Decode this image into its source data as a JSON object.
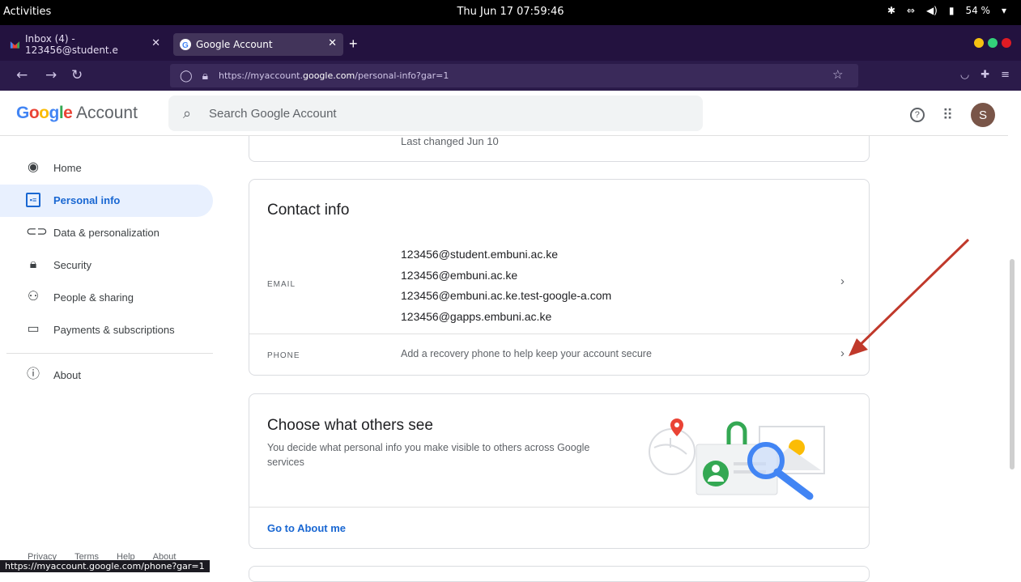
{
  "system": {
    "activities": "Activities",
    "clock": "Thu Jun 17  07:59:46",
    "battery": "54 %"
  },
  "browser": {
    "tabs": [
      {
        "title": "Inbox (4) - 123456@student.e"
      },
      {
        "title": "Google Account"
      }
    ],
    "url_prefix": "https://myaccount.",
    "url_domain": "google.com",
    "url_suffix": "/personal-info?gar=1",
    "status_url": "https://myaccount.google.com/phone?gar=1"
  },
  "app": {
    "logo_google": "Google",
    "logo_account": " Account",
    "search_placeholder": "Search Google Account",
    "avatar_letter": "S"
  },
  "sidebar": {
    "items": [
      {
        "label": "Home",
        "icon": "account-circle-icon"
      },
      {
        "label": "Personal info",
        "icon": "id-card-icon"
      },
      {
        "label": "Data & personalization",
        "icon": "toggle-icon"
      },
      {
        "label": "Security",
        "icon": "lock-icon"
      },
      {
        "label": "People & sharing",
        "icon": "people-icon"
      },
      {
        "label": "Payments & subscriptions",
        "icon": "credit-card-icon"
      },
      {
        "label": "About",
        "icon": "info-icon"
      }
    ],
    "footer": [
      "Privacy",
      "Terms",
      "Help",
      "About"
    ]
  },
  "password_card": {
    "last_changed": "Last changed Jun 10"
  },
  "contact": {
    "title": "Contact info",
    "email_label": "EMAIL",
    "emails": [
      "123456@student.embuni.ac.ke",
      "123456@embuni.ac.ke",
      "123456@embuni.ac.ke.test-google-a.com",
      "123456@gapps.embuni.ac.ke"
    ],
    "phone_label": "PHONE",
    "phone_text": "Add a recovery phone to help keep your account secure"
  },
  "others": {
    "title": "Choose what others see",
    "desc": "You decide what personal info you make visible to others across Google services",
    "link": "Go to About me"
  },
  "colors": {
    "accent": "#1967d2",
    "annotation_arrow": "#c0392b"
  }
}
